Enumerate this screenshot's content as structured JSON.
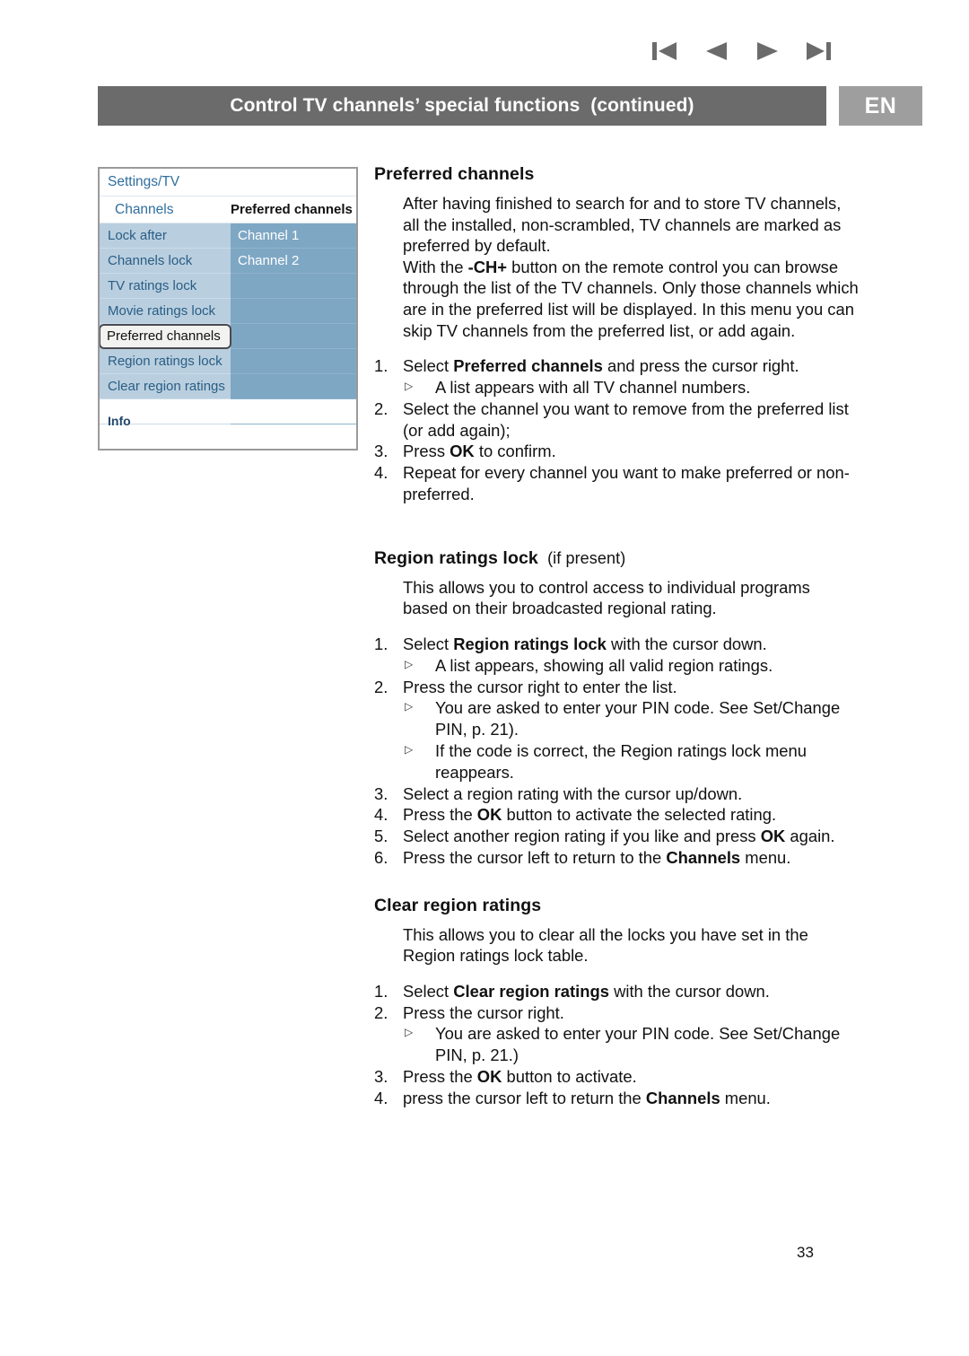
{
  "nav": {
    "items": [
      {
        "name": "skip-first",
        "label": "First page"
      },
      {
        "name": "previous",
        "label": "Previous page"
      },
      {
        "name": "next",
        "label": "Next page"
      },
      {
        "name": "skip-last",
        "label": "Last page"
      }
    ]
  },
  "header": {
    "title": "Control TV channels’ special functions  (continued)",
    "language_badge": "EN",
    "bar_color": "#6b6b6b",
    "badge_color": "#9e9e9e"
  },
  "tv_menu": {
    "breadcrumb": "Settings/TV",
    "column_left_header": "Channels",
    "column_right_header": "Preferred channels",
    "left_items": [
      {
        "label": "Lock after",
        "selected": false
      },
      {
        "label": "Channels lock",
        "selected": false
      },
      {
        "label": "TV ratings lock",
        "selected": false
      },
      {
        "label": "Movie ratings lock",
        "selected": false
      },
      {
        "label": "Preferred channels",
        "selected": true
      },
      {
        "label": "Region ratings lock",
        "selected": false
      },
      {
        "label": "Clear region ratings",
        "selected": false
      },
      {
        "label": "",
        "selected": false
      }
    ],
    "right_items": [
      {
        "label": "Channel 1"
      },
      {
        "label": "Channel 2"
      },
      {
        "label": ""
      },
      {
        "label": ""
      },
      {
        "label": ""
      },
      {
        "label": ""
      },
      {
        "label": ""
      },
      {
        "label": ""
      }
    ],
    "info_label": "Info",
    "colors": {
      "left_panel": "#b9cfdf",
      "right_panel": "#7ea7c4",
      "link_text": "#2f6e9e"
    }
  },
  "sections": {
    "preferred_channels": {
      "heading": "Preferred channels",
      "paragraphs": [
        "After having finished to search for and to store TV channels, all the installed, non-scrambled, TV channels are marked as preferred by default.",
        "With the -CH+ button on the remote control you can browse through the list of the TV channels. Only those channels which are in the preferred list will be displayed. In this menu you can skip TV channels from the preferred list, or add again."
      ],
      "para2_pre": "With the ",
      "para2_bold": "-CH+",
      "para2_post": " button on the remote control you can browse through the list of the TV channels. Only those channels which are in the preferred list will be displayed. In this menu you can skip TV channels from the preferred list, or add again.",
      "steps": [
        {
          "num": "1.",
          "pre": "Select ",
          "bold": "Preferred channels",
          "post": " and press the cursor right.",
          "subs": [
            "A list appears with all TV channel numbers."
          ]
        },
        {
          "num": "2.",
          "pre": "Select the channel you want to remove from the preferred list (or add again);",
          "bold": "",
          "post": "",
          "subs": []
        },
        {
          "num": "3.",
          "pre": "Press ",
          "bold": "OK",
          "post": " to confirm.",
          "subs": []
        },
        {
          "num": "4.",
          "pre": "Repeat for every channel you want to make preferred or non-preferred.",
          "bold": "",
          "post": "",
          "subs": []
        }
      ]
    },
    "region_ratings_lock": {
      "heading": "Region ratings lock",
      "heading_qualifier": "(if present)",
      "paragraph": "This allows you to control access to individual programs based on their broadcasted regional rating.",
      "steps": [
        {
          "num": "1.",
          "pre": "Select ",
          "bold": "Region ratings lock",
          "post": " with the cursor down.",
          "subs": [
            "A list appears, showing all valid region ratings."
          ]
        },
        {
          "num": "2.",
          "pre": "Press the cursor right to enter the list.",
          "bold": "",
          "post": "",
          "subs": [
            "You are asked to enter your PIN code. See Set/Change PIN, p. 21).",
            "If the code is correct, the Region ratings lock menu reappears."
          ]
        },
        {
          "num": "3.",
          "pre": "Select a region rating with the cursor up/down.",
          "bold": "",
          "post": "",
          "subs": []
        },
        {
          "num": "4.",
          "pre": "Press the ",
          "bold": "OK",
          "post": " button to activate the selected rating.",
          "subs": []
        },
        {
          "num": "5.",
          "pre": "Select another region rating if you like and press ",
          "bold": "OK",
          "post": " again.",
          "subs": []
        },
        {
          "num": "6.",
          "pre": "Press the cursor left to return to the ",
          "bold": "Channels",
          "post": " menu.",
          "subs": []
        }
      ]
    },
    "clear_region_ratings": {
      "heading": "Clear region ratings",
      "paragraph": "This allows you to clear all the locks you have set in the Region ratings lock table.",
      "steps": [
        {
          "num": "1.",
          "pre": "Select ",
          "bold": "Clear region ratings",
          "post": " with the cursor down.",
          "subs": []
        },
        {
          "num": "2.",
          "pre": "Press the cursor right.",
          "bold": "",
          "post": "",
          "subs": [
            "You are asked to enter your PIN code. See Set/Change PIN, p. 21.)"
          ]
        },
        {
          "num": "3.",
          "pre": "Press the ",
          "bold": "OK",
          "post": " button to activate.",
          "subs": []
        },
        {
          "num": "4.",
          "pre": "press the cursor left to return the ",
          "bold": "Channels",
          "post": " menu.",
          "subs": []
        }
      ]
    }
  },
  "footer": {
    "page_number": "33"
  }
}
